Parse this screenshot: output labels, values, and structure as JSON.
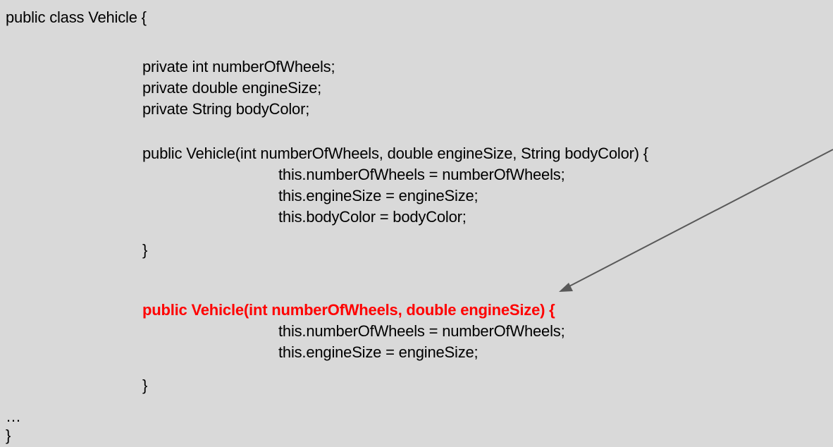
{
  "code": {
    "class_decl": "public class Vehicle {",
    "fields": [
      "private int numberOfWheels;",
      "private double engineSize;",
      "private String bodyColor;"
    ],
    "constructor_full": {
      "signature": "public Vehicle(int numberOfWheels, double engineSize, String bodyColor) {",
      "body": [
        "this.numberOfWheels = numberOfWheels;",
        "this.engineSize = engineSize;",
        "this.bodyColor = bodyColor;"
      ],
      "close": "}"
    },
    "constructor_partial": {
      "signature": "public Vehicle(int numberOfWheels, double engineSize) {",
      "body": [
        "this.numberOfWheels = numberOfWheels;",
        "this.engineSize = engineSize;"
      ],
      "close": "}"
    },
    "ellipsis": "…",
    "class_close": "}"
  },
  "colors": {
    "background": "#d9d9d9",
    "highlight": "#ff0000",
    "arrow": "#595959"
  }
}
